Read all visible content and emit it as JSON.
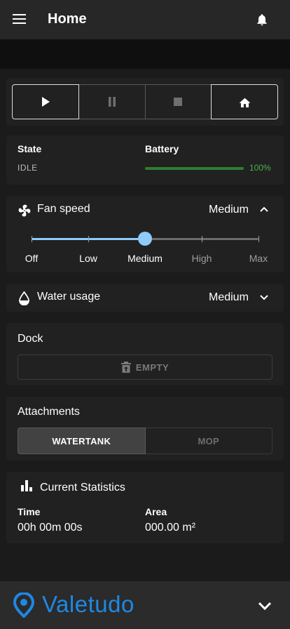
{
  "header": {
    "title": "Home"
  },
  "controls": [
    "play",
    "pause",
    "stop",
    "home"
  ],
  "status": {
    "state_label": "State",
    "state_value": "IDLE",
    "battery_label": "Battery",
    "battery_value": "100%",
    "battery_level": 1.0
  },
  "fan_speed": {
    "label": "Fan speed",
    "value": "Medium",
    "ticks": [
      "Off",
      "Low",
      "Medium",
      "High",
      "Max"
    ],
    "selected_index": 2
  },
  "water_usage": {
    "label": "Water usage",
    "value": "Medium"
  },
  "dock": {
    "label": "Dock",
    "button": "EMPTY"
  },
  "attachments": {
    "label": "Attachments",
    "options": [
      "WATERTANK",
      "MOP"
    ],
    "selected": "WATERTANK"
  },
  "statistics": {
    "label": "Current Statistics",
    "time_label": "Time",
    "time_value": "00h 00m 00s",
    "area_label": "Area",
    "area_value": "000.00 m²"
  },
  "footer": {
    "brand": "Valetudo"
  },
  "colors": {
    "accent": "#90caf9",
    "battery": "#2e7d32",
    "battery_text": "#4caf50",
    "brand": "#1e88e5"
  }
}
